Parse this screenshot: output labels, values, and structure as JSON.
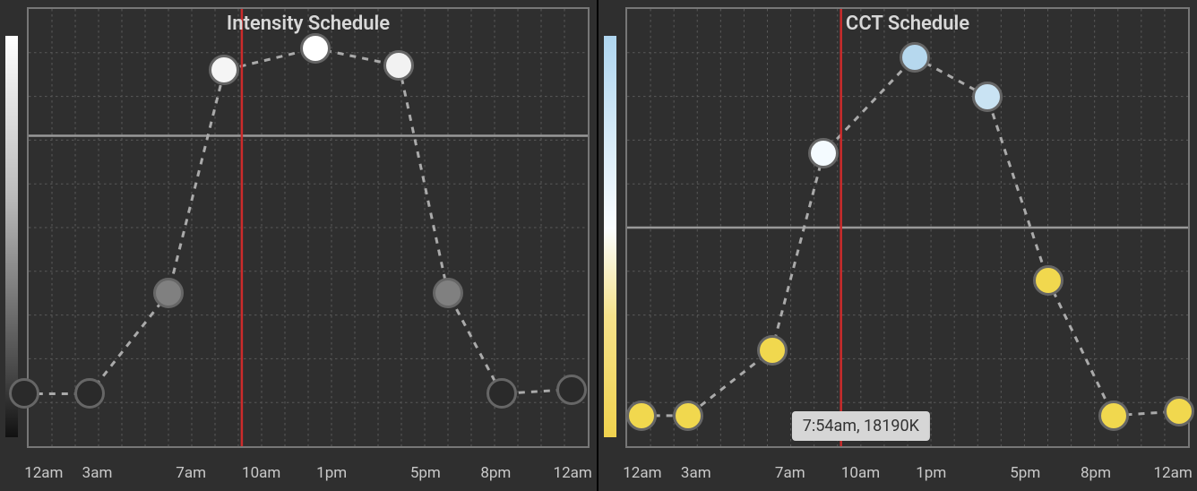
{
  "chart_data": [
    {
      "type": "line",
      "title": "Intensity Schedule",
      "xlabel": "",
      "ylabel": "",
      "x_ticks": [
        "12am",
        "3am",
        "7am",
        "10am",
        "1pm",
        "5pm",
        "8pm",
        "12am"
      ],
      "x_hours": [
        0,
        3,
        7,
        10,
        13,
        17,
        20,
        24
      ],
      "ylim": [
        0,
        100
      ],
      "current_time_hours": 9.15,
      "reference_line_y": 71,
      "gradient": "intensity",
      "series": [
        {
          "name": "Intensity",
          "points": [
            {
              "hour": -0.2,
              "value": 12,
              "color": "#2a2a2a"
            },
            {
              "hour": 2.6,
              "value": 12,
              "color": "#2a2a2a"
            },
            {
              "hour": 6.0,
              "value": 35,
              "color": "#808080"
            },
            {
              "hour": 8.4,
              "value": 86,
              "color": "#f5f5f5"
            },
            {
              "hour": 12.3,
              "value": 91,
              "color": "#ffffff"
            },
            {
              "hour": 15.9,
              "value": 87,
              "color": "#f2f2f2"
            },
            {
              "hour": 18.0,
              "value": 35,
              "color": "#808080"
            },
            {
              "hour": 20.3,
              "value": 12,
              "color": "#2a2a2a"
            },
            {
              "hour": 23.3,
              "value": 13,
              "color": "#2a2a2a"
            }
          ]
        }
      ]
    },
    {
      "type": "line",
      "title": "CCT Schedule",
      "xlabel": "",
      "ylabel": "",
      "x_ticks": [
        "12am",
        "3am",
        "7am",
        "10am",
        "1pm",
        "5pm",
        "8pm",
        "12am"
      ],
      "x_hours": [
        0,
        3,
        7,
        10,
        13,
        17,
        20,
        24
      ],
      "ylim": [
        0,
        100
      ],
      "current_time_hours": 9.15,
      "reference_line_y": 50,
      "gradient": "cct",
      "tooltip": {
        "hour": 10.0,
        "text": "7:54am, 18190K"
      },
      "series": [
        {
          "name": "CCT",
          "points": [
            {
              "hour": 0.6,
              "value": 7,
              "color": "#f1d84e"
            },
            {
              "hour": 2.6,
              "value": 7,
              "color": "#f1d84e"
            },
            {
              "hour": 6.2,
              "value": 22,
              "color": "#f1d84e"
            },
            {
              "hour": 8.4,
              "value": 67,
              "color": "#f4fbff"
            },
            {
              "hour": 12.3,
              "value": 89,
              "color": "#b6d8ee"
            },
            {
              "hour": 15.4,
              "value": 80,
              "color": "#c9e3f3"
            },
            {
              "hour": 18.0,
              "value": 38,
              "color": "#f1d84e"
            },
            {
              "hour": 20.8,
              "value": 7,
              "color": "#f1d84e"
            },
            {
              "hour": 23.6,
              "value": 8,
              "color": "#f1d84e"
            }
          ]
        }
      ]
    }
  ]
}
